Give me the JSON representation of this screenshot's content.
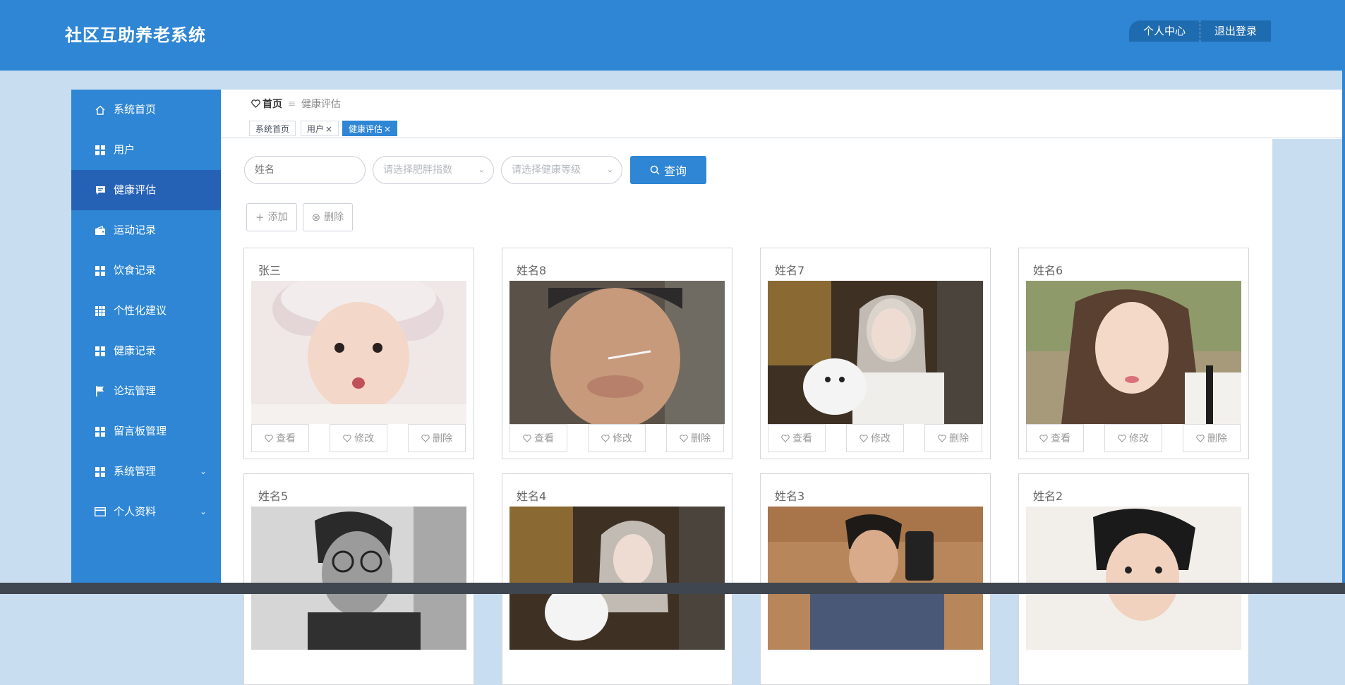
{
  "header": {
    "app_title": "社区互助养老系统",
    "profile_label": "个人中心",
    "logout_label": "退出登录"
  },
  "sidebar": {
    "items": [
      {
        "label": "系统首页",
        "icon": "home-icon"
      },
      {
        "label": "用户",
        "icon": "grid-icon"
      },
      {
        "label": "健康评估",
        "icon": "chat-icon",
        "active": true
      },
      {
        "label": "运动记录",
        "icon": "wallet-icon"
      },
      {
        "label": "饮食记录",
        "icon": "grid-icon"
      },
      {
        "label": "个性化建议",
        "icon": "apps-icon"
      },
      {
        "label": "健康记录",
        "icon": "grid-icon"
      },
      {
        "label": "论坛管理",
        "icon": "flag-icon"
      },
      {
        "label": "留言板管理",
        "icon": "grid-icon"
      },
      {
        "label": "系统管理",
        "icon": "grid-icon",
        "expandable": true
      },
      {
        "label": "个人资料",
        "icon": "card-icon",
        "expandable": true
      }
    ]
  },
  "breadcrumb": {
    "home": "首页",
    "current": "健康评估"
  },
  "tabs": [
    {
      "label": "系统首页"
    },
    {
      "label": "用户",
      "closable": true
    },
    {
      "label": "健康评估",
      "closable": true,
      "active": true
    }
  ],
  "search": {
    "name_placeholder": "姓名",
    "obesity_placeholder": "请选择肥胖指数",
    "health_level_placeholder": "请选择健康等级",
    "query_label": "查询"
  },
  "actions": {
    "add_label": "添加",
    "delete_label": "删除"
  },
  "card_actions": {
    "view": "查看",
    "edit": "修改",
    "delete": "删除"
  },
  "cards": [
    {
      "name": "张三"
    },
    {
      "name": "姓名8"
    },
    {
      "name": "姓名7"
    },
    {
      "name": "姓名6"
    },
    {
      "name": "姓名5"
    },
    {
      "name": "姓名4"
    },
    {
      "name": "姓名3"
    },
    {
      "name": "姓名2"
    }
  ],
  "colors": {
    "primary": "#2e86d4",
    "active_nav": "#2562b5",
    "page_bg": "#c9ddf0"
  }
}
